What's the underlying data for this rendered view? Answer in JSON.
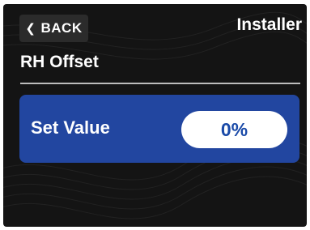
{
  "header": {
    "back_icon": "chevron-left-icon",
    "back_label": "BACK",
    "mode_label": "Installer"
  },
  "page": {
    "title": "RH Offset"
  },
  "setting": {
    "label": "Set Value",
    "value": "0%"
  },
  "colors": {
    "panel_background": "#141414",
    "back_button": "#2b2b2b",
    "row_background": "#2246a0",
    "value_pill": "#ffffff",
    "value_text": "#1a4aa8"
  }
}
